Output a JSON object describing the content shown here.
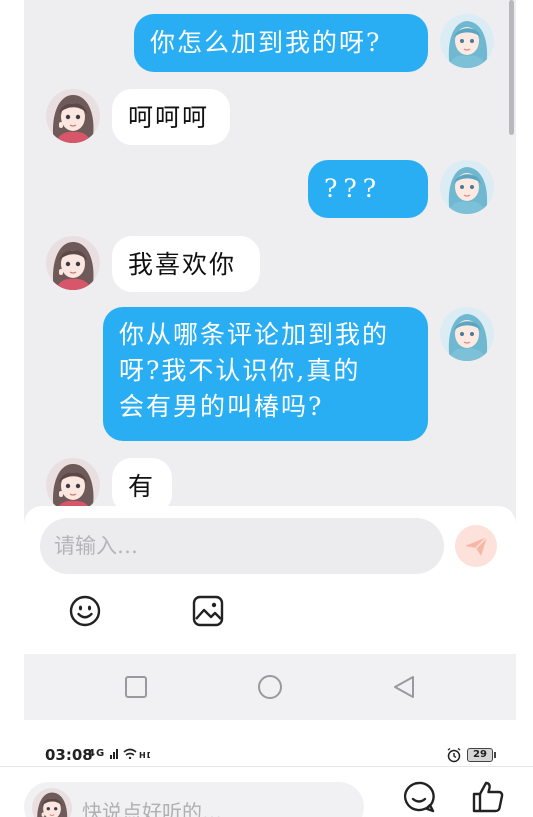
{
  "chat": {
    "messages": [
      {
        "side": "out",
        "text": "你怎么加到我的呀?"
      },
      {
        "side": "in",
        "text": "呵呵呵"
      },
      {
        "side": "out",
        "text": "???"
      },
      {
        "side": "in",
        "text": "我喜欢你"
      },
      {
        "side": "out",
        "lines": [
          "你从哪条评论加到我的",
          "呀?我不认识你,真的",
          "会有男的叫椿吗?"
        ]
      },
      {
        "side": "in",
        "text": "有"
      }
    ]
  },
  "input": {
    "placeholder": "请输入…"
  },
  "status_bar": {
    "time": "03:08",
    "network": "4G",
    "battery": "29"
  },
  "comment_bar": {
    "placeholder": "快说点好听的…"
  },
  "icons": {
    "send": "send-icon",
    "emoji": "emoji-icon",
    "image": "image-icon",
    "nav_recent": "square-icon",
    "nav_home": "circle-icon",
    "nav_back": "triangle-back-icon",
    "comment": "comment-icon",
    "like": "thumbs-up-icon",
    "alarm": "alarm-icon"
  },
  "colors": {
    "outgoing_bubble": "#2aaef3",
    "incoming_bubble": "#ffffff",
    "chat_background": "#eeeef0",
    "send_button": "#fce2db"
  }
}
